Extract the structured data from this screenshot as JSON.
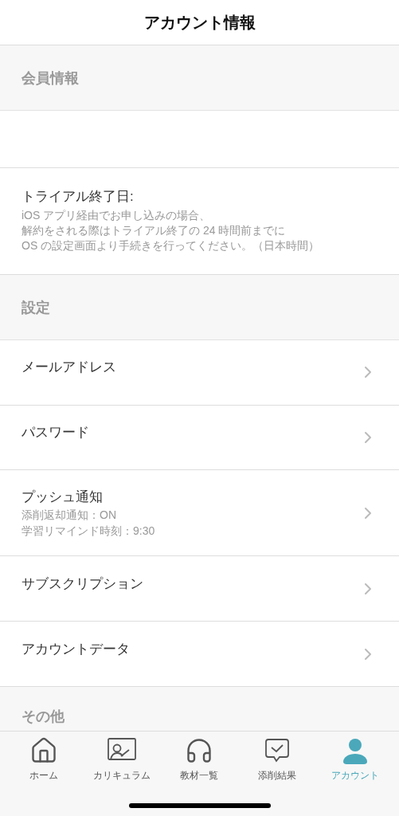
{
  "header": {
    "title": "アカウント情報"
  },
  "items": [
    {
      "kind": "section",
      "label": "会員情報"
    },
    {
      "kind": "blank"
    },
    {
      "kind": "note",
      "label": "トライアル終了日:",
      "lines": [
        "iOS アプリ経由でお申し込みの場合、",
        "解約をされる際はトライアル終了の 24 時間前までに",
        "OS の設定画面より手続きを行ってください。（日本時間）"
      ]
    },
    {
      "kind": "section",
      "label": "設定"
    },
    {
      "kind": "link",
      "label": "メールアドレス"
    },
    {
      "kind": "link",
      "label": "パスワード"
    },
    {
      "kind": "link",
      "label": "プッシュ通知",
      "lines": [
        "添削返却通知：ON",
        "学習リマインド時刻：9:30"
      ]
    },
    {
      "kind": "link",
      "label": "サブスクリプション"
    },
    {
      "kind": "link",
      "label": "アカウントデータ"
    },
    {
      "kind": "section",
      "label": "その他"
    }
  ],
  "tabs": [
    {
      "kind": "home",
      "label": "ホーム",
      "selected": false
    },
    {
      "kind": "board",
      "label": "カリキュラム",
      "selected": false
    },
    {
      "kind": "headphones",
      "label": "教材一覧",
      "selected": false
    },
    {
      "kind": "check",
      "label": "添削結果",
      "selected": false
    },
    {
      "kind": "user",
      "label": "アカウント",
      "selected": true
    }
  ]
}
